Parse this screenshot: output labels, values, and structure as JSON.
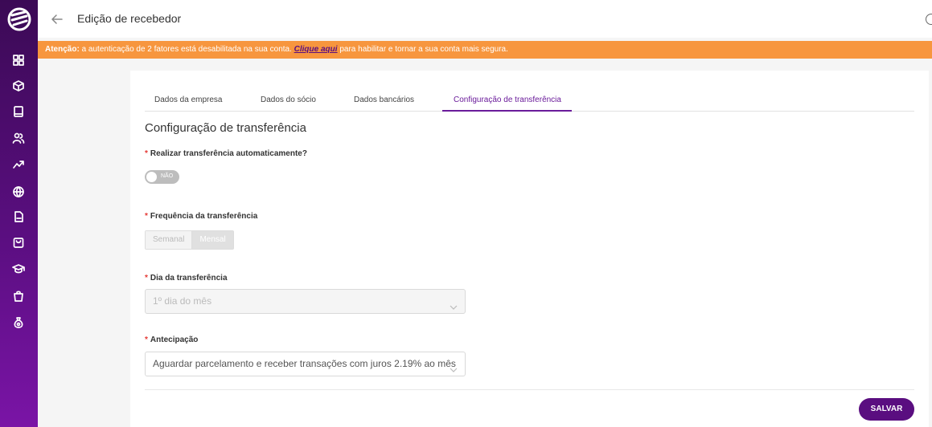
{
  "header": {
    "title": "Edição de recebedor"
  },
  "banner": {
    "prefix": "Atenção:",
    "message": " a autenticação de 2 fatores está desabilitada na sua conta. ",
    "link": "Clique aqui",
    "suffix": " para habilitar e tornar a sua conta mais segura."
  },
  "tabs": [
    {
      "label": "Dados da empresa"
    },
    {
      "label": "Dados do sócio"
    },
    {
      "label": "Dados bancários"
    },
    {
      "label": "Configuração de transferência",
      "active": true
    }
  ],
  "form": {
    "title": "Configuração de transferência",
    "required_mark": "*",
    "auto_transfer": {
      "label": "Realizar transferência automaticamente?",
      "toggle_text": "NÃO",
      "enabled": false
    },
    "frequency": {
      "label": "Frequência da transferência",
      "options": [
        "Semanal",
        "Mensal"
      ],
      "selected": "Mensal"
    },
    "day": {
      "label": "Dia da transferência",
      "value": "1º dia do mês",
      "disabled": true
    },
    "anticipation": {
      "label": "Antecipação",
      "value": "Aguardar parcelamento e receber transações com juros 2.19% ao mês"
    },
    "save_label": "SALVAR"
  },
  "colors": {
    "primary": "#5a0e80",
    "banner": "#f7963e",
    "required": "#e53935"
  },
  "sidebar_icons": [
    "dashboard-icon",
    "box-icon",
    "book-icon",
    "users-icon",
    "trend-icon",
    "globe-icon",
    "document-icon",
    "shopping-bag-icon",
    "graduation-cap-icon",
    "bag-icon",
    "money-bag-icon"
  ]
}
